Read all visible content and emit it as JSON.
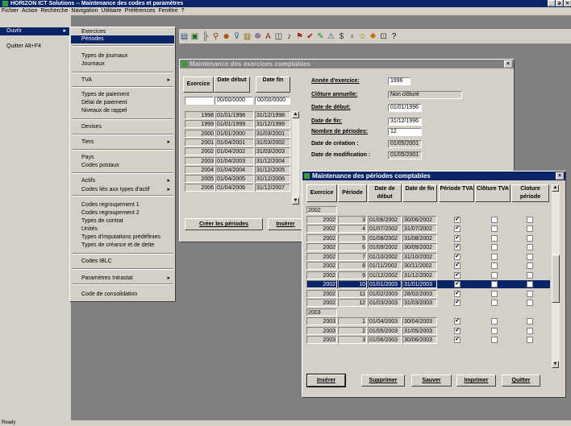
{
  "window": {
    "title": "HORIZON ICT Solutions -- Maintenance des codes et paramètres",
    "buttons": [
      "_",
      "ə",
      "×"
    ]
  },
  "menubar": [
    "Fichier",
    "Action",
    "Recherche",
    "Navigation",
    "Utilitaire",
    "Préférences",
    "Fenêtre",
    "?"
  ],
  "leftpanel": {
    "ouvrir": "Ouvrir",
    "quitter": "Quitter  Alt+F4"
  },
  "submenu": {
    "items": [
      {
        "label": "Exercices"
      },
      {
        "label": "Périodes"
      },
      {
        "label": "Types de journaux"
      },
      {
        "label": "Journaux"
      },
      {
        "label": "TVA"
      },
      {
        "label": "Types de paiement"
      },
      {
        "label": "Délai de paiement"
      },
      {
        "label": "Niveaux de rappel"
      },
      {
        "label": "Devises"
      },
      {
        "label": "Tiers"
      },
      {
        "label": "Pays"
      },
      {
        "label": "Codes postaux"
      },
      {
        "label": "Actifs"
      },
      {
        "label": "Codes liés aux types d'actif"
      },
      {
        "label": "Codes regroupement 1"
      },
      {
        "label": "Codes regroupement 2"
      },
      {
        "label": "Types de contrat"
      },
      {
        "label": "Unités"
      },
      {
        "label": "Types d'imputations prédéfinies"
      },
      {
        "label": "Types de créance et de dette"
      },
      {
        "label": "Codes IBLC"
      },
      {
        "label": "Paramètres Intrastat"
      },
      {
        "label": "Code de consolidation"
      }
    ]
  },
  "exercices_window": {
    "title": "Maintenance des exercices comptables",
    "headers": [
      "Exercice",
      "Date début",
      "Date fin"
    ],
    "filter": [
      "",
      "00/00/0000",
      "00/00/0000"
    ],
    "rows": [
      [
        "1998",
        "01/01/1998",
        "31/12/1998"
      ],
      [
        "1999",
        "01/01/1999",
        "31/12/1999"
      ],
      [
        "2000",
        "01/01/2000",
        "31/03/2001"
      ],
      [
        "2001",
        "01/04/2001",
        "31/03/2002"
      ],
      [
        "2002",
        "01/04/2002",
        "31/03/2003"
      ],
      [
        "2003",
        "01/04/2003",
        "31/12/2004"
      ],
      [
        "2004",
        "01/04/2004",
        "31/12/2005"
      ],
      [
        "2005",
        "01/04/2005",
        "31/12/2006"
      ],
      [
        "2006",
        "01/04/2006",
        "31/12/2007"
      ]
    ],
    "details": {
      "annee_label": "Année d'exercice:",
      "annee_value": "1996",
      "cloture_label": "Clôture annuelle:",
      "cloture_value": "Non clôturé",
      "debut_label": "Date de début:",
      "debut_value": "01/01/1996",
      "fin_label": "Date de fin:",
      "fin_value": "31/12/1996",
      "nb_label": "Nombre de périodes:",
      "nb_value": "12",
      "creation_label": "Date de création :",
      "creation_value": "01/05/2001",
      "modif_label": "Date de modification :",
      "modif_value": "01/05/2001"
    },
    "buttons": {
      "creer": "Créer les périodes",
      "inserer": "Insérer"
    }
  },
  "periodes_window": {
    "title": "Maintenance des périodes comptables",
    "headers": [
      "Exercice",
      "Période",
      "Date de début",
      "Date de fin",
      "Période TVA",
      "Clôture TVA",
      "Cloture période"
    ],
    "rows": [
      {
        "group": "2002"
      },
      {
        "ex": "2002",
        "per": "3",
        "debut": "01/06/2002",
        "fin": "30/06/2002",
        "tva": true
      },
      {
        "ex": "2002",
        "per": "4",
        "debut": "01/07/2002",
        "fin": "31/07/2002",
        "tva": true
      },
      {
        "ex": "2002",
        "per": "5",
        "debut": "01/08/2002",
        "fin": "31/08/2002",
        "tva": true
      },
      {
        "ex": "2002",
        "per": "6",
        "debut": "01/09/2002",
        "fin": "30/09/2002",
        "tva": true
      },
      {
        "ex": "2002",
        "per": "7",
        "debut": "01/10/2002",
        "fin": "31/10/2002",
        "tva": true
      },
      {
        "ex": "2002",
        "per": "8",
        "debut": "01/11/2002",
        "fin": "30/11/2002",
        "tva": true
      },
      {
        "ex": "2002",
        "per": "9",
        "debut": "01/12/2002",
        "fin": "31/12/2002",
        "tva": true
      },
      {
        "ex": "2002",
        "per": "10",
        "debut": "01/01/2003",
        "fin": "31/01/2003",
        "tva": true,
        "selected": true
      },
      {
        "ex": "2002",
        "per": "11",
        "debut": "01/02/2003",
        "fin": "28/02/2003",
        "tva": true
      },
      {
        "ex": "2002",
        "per": "12",
        "debut": "01/03/2003",
        "fin": "31/03/2003",
        "tva": true
      },
      {
        "group": "2003"
      },
      {
        "ex": "2003",
        "per": "1",
        "debut": "01/04/2003",
        "fin": "30/04/2003",
        "tva": true
      },
      {
        "ex": "2003",
        "per": "2",
        "debut": "01/05/2003",
        "fin": "31/05/2003",
        "tva": true
      },
      {
        "ex": "2003",
        "per": "3",
        "debut": "01/06/2003",
        "fin": "30/06/2003",
        "tva": true
      }
    ],
    "buttons": [
      "Insérer",
      "Supprimer",
      "Sauver",
      "Imprimer",
      "Quitter"
    ]
  },
  "statusbar": "Ready",
  "colors": {
    "titlebar": "#0a246a",
    "face": "#d4d0c8",
    "desktop": "#808080",
    "selection": "#0a246a"
  }
}
